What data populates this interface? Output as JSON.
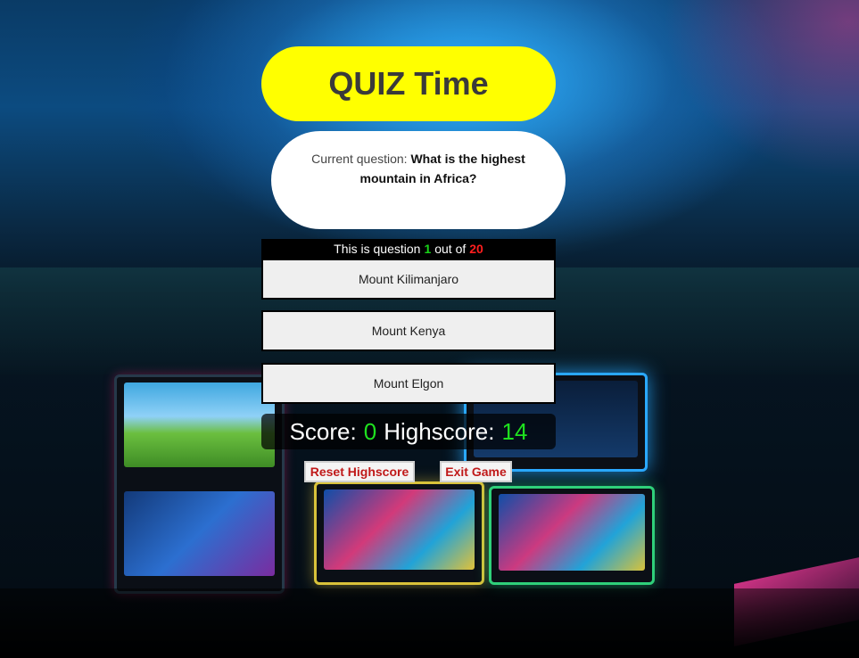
{
  "title": "QUIZ Time",
  "question": {
    "prefix": "Current question:",
    "text": "What is the highest mountain in Africa?"
  },
  "progress": {
    "before": "This is question",
    "current": "1",
    "middle": "out of",
    "total": "20"
  },
  "answers": [
    {
      "label": "Mount Kilimanjaro"
    },
    {
      "label": "Mount Kenya"
    },
    {
      "label": "Mount Elgon"
    }
  ],
  "score": {
    "score_label": "Score:",
    "score_value": "0",
    "highscore_label": "Highscore:",
    "highscore_value": "14"
  },
  "buttons": {
    "reset_label": "Reset Highscore",
    "exit_label": "Exit Game"
  },
  "colors": {
    "title_bg": "#ffff00",
    "progress_current": "#19d419",
    "progress_total": "#ff1e1e",
    "score_value": "#1fe11f",
    "button_text": "#c01a1a"
  },
  "background": {
    "icon": "arcade-slot-machines-photo"
  }
}
